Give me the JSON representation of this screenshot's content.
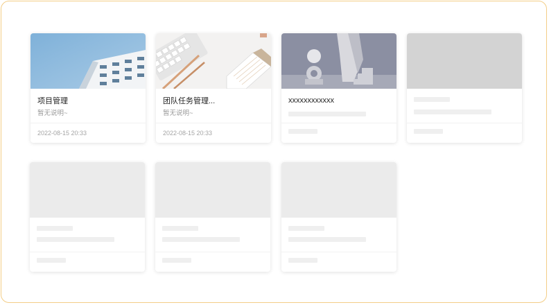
{
  "cards": [
    {
      "title": "项目管理",
      "description": "暂无说明~",
      "date": "2022-08-15 20:33"
    },
    {
      "title": "团队任务管理...",
      "description": "暂无说明~",
      "date": "2022-08-15 20:33"
    },
    {
      "title": "xxxxxxxxxxxx"
    }
  ],
  "colors": {
    "frame_border": "#f3cd86",
    "skeleton": "#efefef",
    "skeleton_cover": "#d3d3d3"
  }
}
